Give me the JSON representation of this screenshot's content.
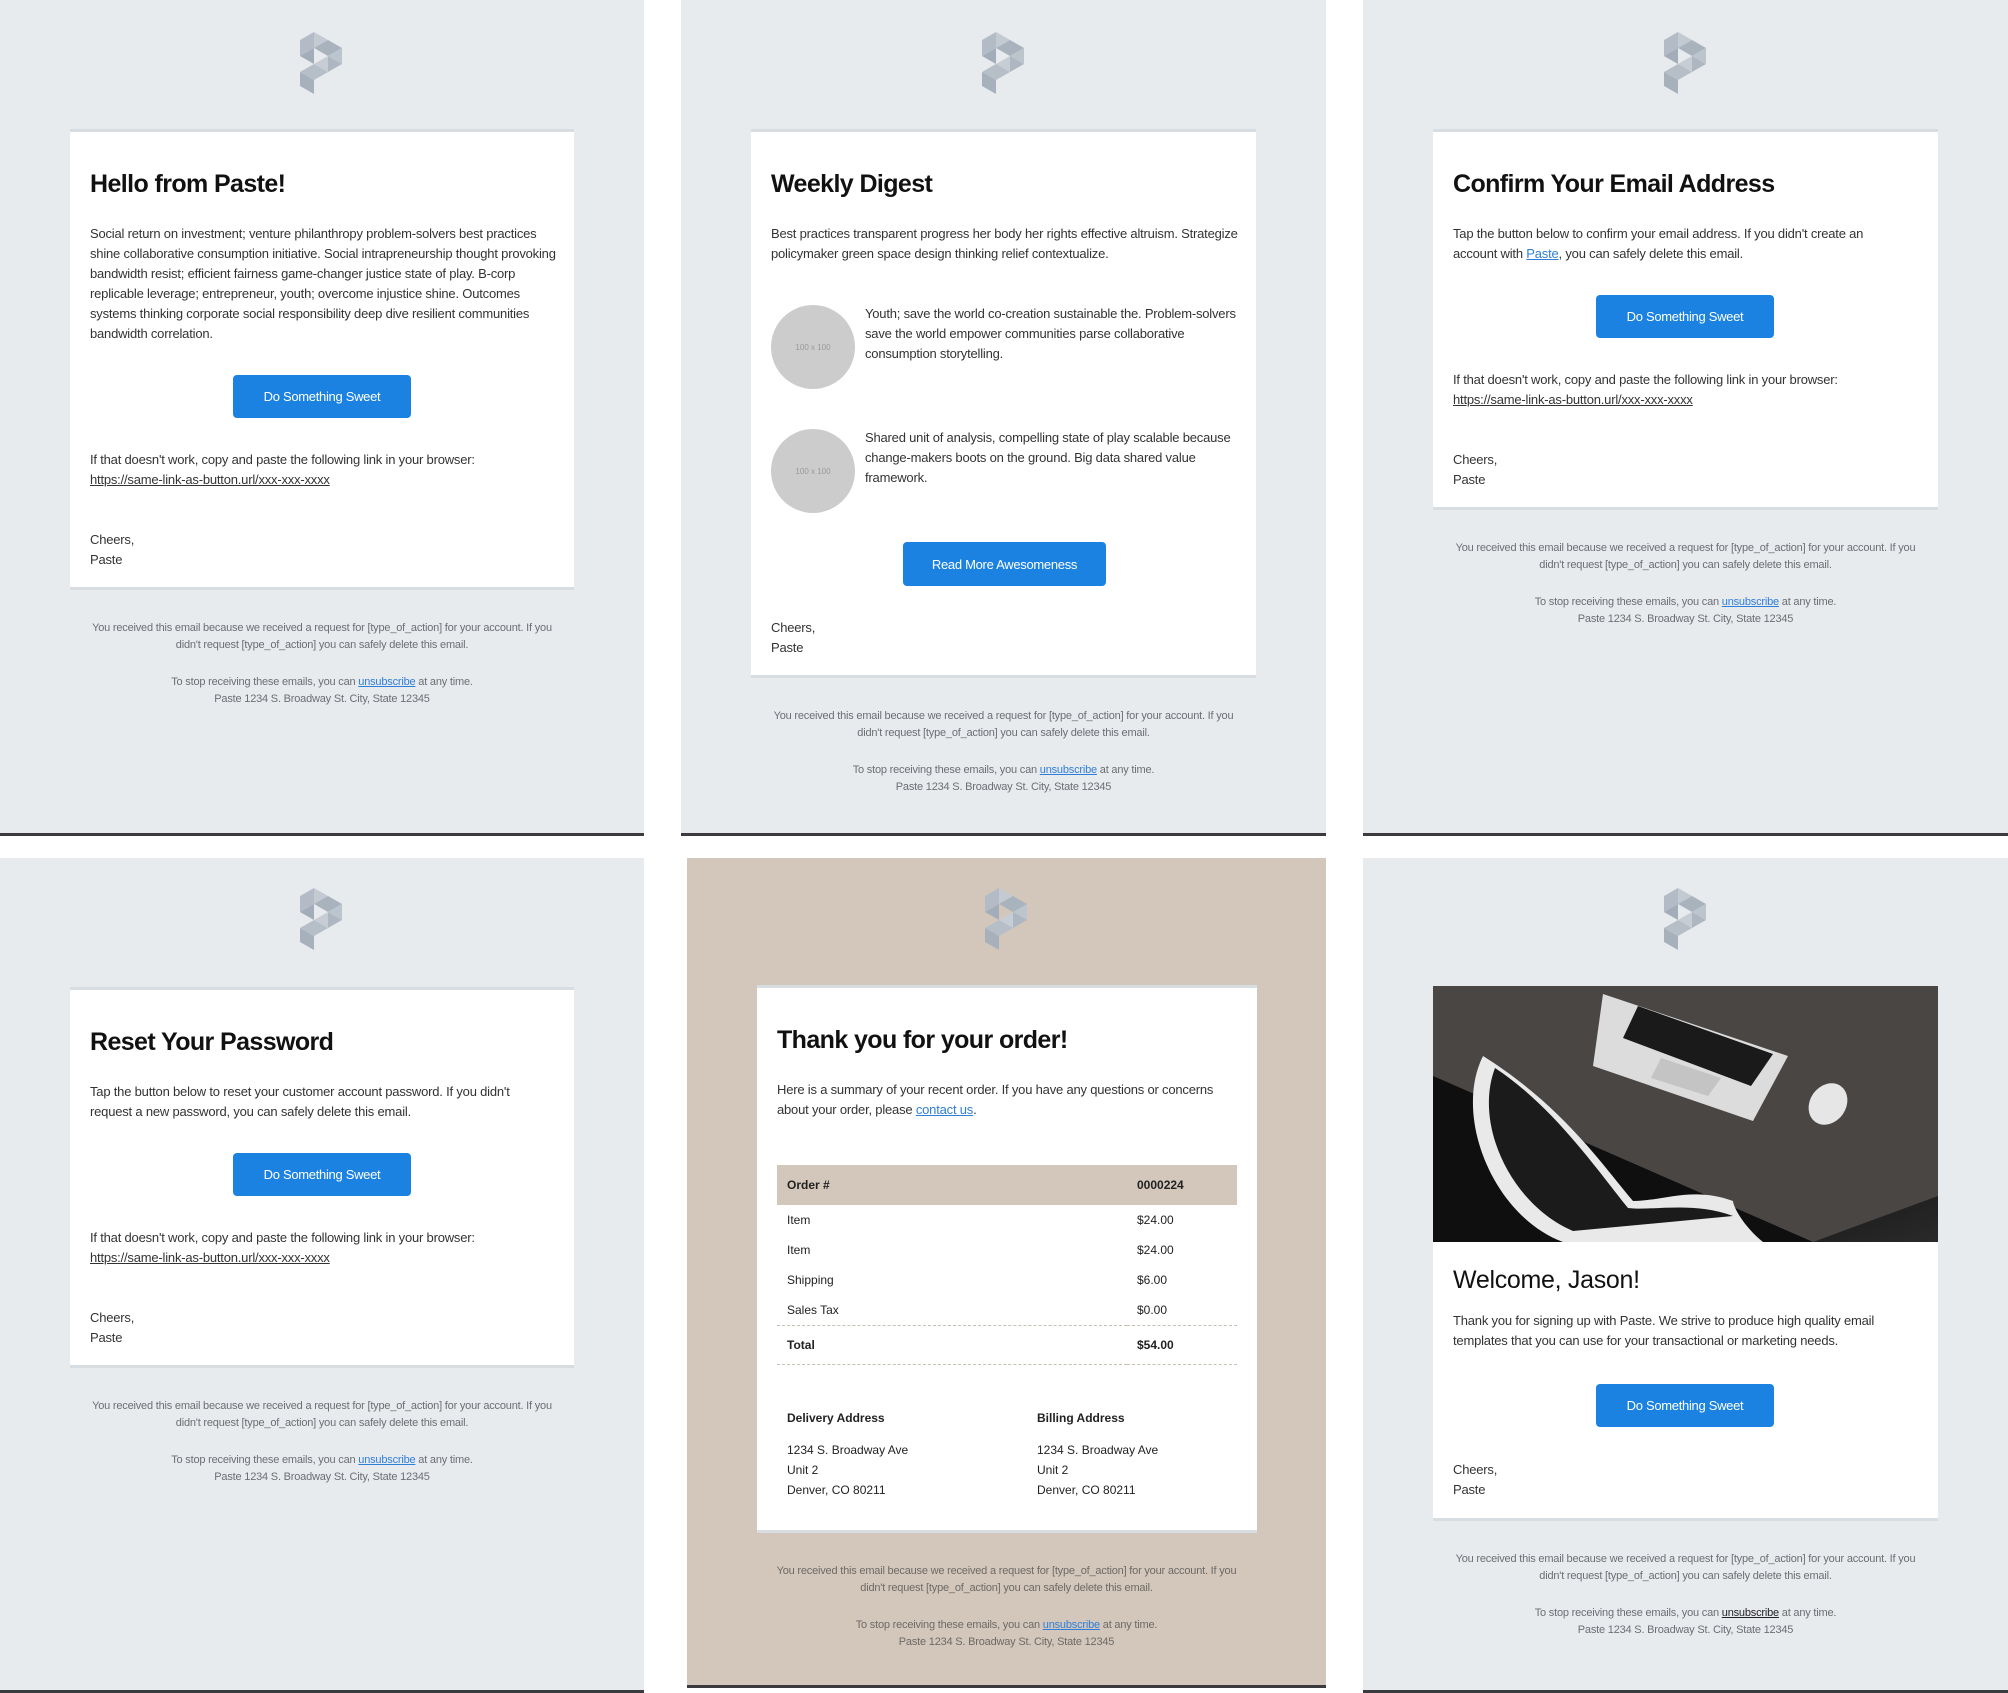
{
  "brand": {
    "logo_icon": "paste-logo-icon",
    "button_color": "#1b82e2",
    "link_color": "#2f7ed8",
    "panel_bg": "#e8ebee",
    "beige_bg": "#d3c7bb"
  },
  "footer": {
    "notice": "You received this email because we received a request for [type_of_action] for your account. If you didn't request [type_of_action] you can safely delete this email.",
    "stop_prefix": "To stop receiving these emails, you can",
    "unsubscribe": "unsubscribe",
    "stop_suffix": "at any time.",
    "address": "Paste 1234 S. Broadway St. City, State 12345"
  },
  "signoff": {
    "line1": "Cheers,",
    "line2": "Paste"
  },
  "fallback": {
    "intro": "If that doesn't work, copy and paste the following link in your browser:",
    "url": "https://same-link-as-button.url/xxx-xxx-xxxx"
  },
  "hello": {
    "title": "Hello from Paste!",
    "body": "Social return on investment; venture philanthropy problem-solvers best practices shine collaborative consumption initiative. Social intrapreneurship thought provoking bandwidth resist; efficient fairness game-changer justice state of play. B-corp replicable leverage; entrepreneur, youth; overcome injustice shine. Outcomes systems thinking corporate social responsibility deep dive resilient communities bandwidth correlation.",
    "button": "Do Something Sweet"
  },
  "digest": {
    "title": "Weekly Digest",
    "intro": "Best practices transparent progress her body her rights effective altruism. Strategize policymaker green space design thinking relief contextualize.",
    "items": [
      {
        "thumb": "100 x 100",
        "text": "Youth; save the world co-creation sustainable the. Problem-solvers save the world empower communities parse collaborative consumption storytelling."
      },
      {
        "thumb": "100 x 100",
        "text": "Shared unit of analysis, compelling state of play scalable because change-makers boots on the ground. Big data shared value framework."
      }
    ],
    "button": "Read More Awesomeness"
  },
  "confirm": {
    "title": "Confirm Your Email Address",
    "body_prefix": "Tap the button below to confirm your email address. If you didn't create an account with",
    "body_link": "Paste",
    "body_suffix": ", you can safely delete this email.",
    "button": "Do Something Sweet"
  },
  "reset": {
    "title": "Reset Your Password",
    "body": "Tap the button below to reset your customer account password. If you didn't request a new password, you can safely delete this email.",
    "button": "Do Something Sweet"
  },
  "order": {
    "title": "Thank you for your order!",
    "body_prefix": "Here is a summary of your recent order. If you have any questions or concerns about your order, please",
    "body_link": "contact us",
    "body_suffix": ".",
    "table": {
      "header": {
        "label": "Order #",
        "value": "0000224"
      },
      "rows": [
        {
          "label": "Item",
          "value": "$24.00"
        },
        {
          "label": "Item",
          "value": "$24.00"
        },
        {
          "label": "Shipping",
          "value": "$6.00"
        },
        {
          "label": "Sales Tax",
          "value": "$0.00"
        }
      ],
      "total": {
        "label": "Total",
        "value": "$54.00"
      }
    },
    "delivery": {
      "heading": "Delivery Address",
      "line1": "1234 S. Broadway Ave",
      "line2": "Unit 2",
      "line3": "Denver, CO 80211"
    },
    "billing": {
      "heading": "Billing Address",
      "line1": "1234 S. Broadway Ave",
      "line2": "Unit 2",
      "line3": "Denver, CO 80211"
    }
  },
  "welcome": {
    "hero_image": "laptop-desk-photo",
    "title": "Welcome, Jason!",
    "body": "Thank you for signing up with Paste. We strive to produce high quality email templates that you can use for your transactional or marketing needs.",
    "button": "Do Something Sweet"
  }
}
